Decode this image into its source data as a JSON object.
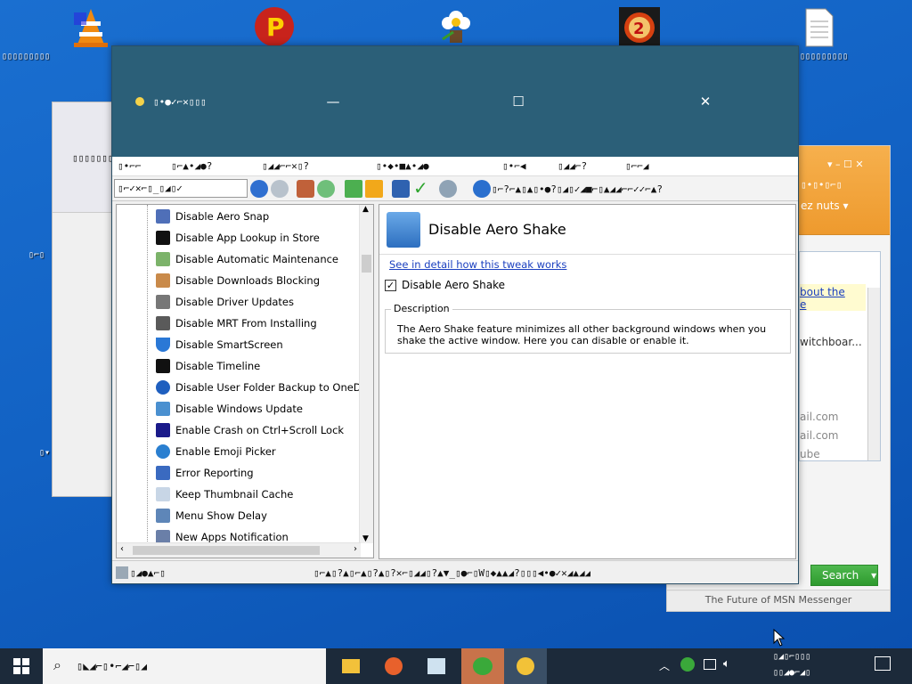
{
  "desktop": {
    "icons": [
      {
        "name": "vlc-icon",
        "label": "▯▯▯▯▯▯▯▯▯"
      },
      {
        "name": "pinball-icon",
        "label": ""
      },
      {
        "name": "flower-app-icon",
        "label": ""
      },
      {
        "name": "pocket-watch-icon",
        "label": ""
      },
      {
        "name": "text-document-icon",
        "label": "▯▯▯▯▯▯▯▯▯"
      }
    ],
    "left_labels": [
      "▯▯▯▯▯▯▯▯▯",
      "▯⌐▯",
      "▯▾"
    ]
  },
  "main_window": {
    "title": "▯•●✓⌐✕▯▯▯",
    "controls": {
      "minimize": "—",
      "maximize": "☐",
      "close": "✕"
    },
    "menu": [
      "▯•⌐⌐",
      "▯⌐▲•◢●?",
      "▯◢◢⌐⌐✕▯?",
      "▯•◆•■▲•◢●",
      "▯•⌐◀",
      "▯◢◢⌐?",
      "▯⌐⌐◢"
    ],
    "toolbar": {
      "address_value": "▯⌐✓✕⌐▯_▯◢▯✓",
      "hint_text": "▯⌐?⌐▲▯▲▯•●?▯◢▯✓◢■⌐▯▲◢◢⌐⌐✓✓⌐▲?"
    },
    "tree_items": [
      "Disable Aero Snap",
      "Disable App Lookup in Store",
      "Disable Automatic Maintenance",
      "Disable Downloads Blocking",
      "Disable Driver Updates",
      "Disable MRT From Installing",
      "Disable SmartScreen",
      "Disable Timeline",
      "Disable User Folder Backup to OneDrive",
      "Disable Windows Update",
      "Enable Crash on Ctrl+Scroll Lock",
      "Enable Emoji Picker",
      "Error Reporting",
      "Keep Thumbnail Cache",
      "Menu Show Delay",
      "New Apps Notification"
    ],
    "detail": {
      "heading": "Disable Aero Shake",
      "link": "See in detail how this tweak works",
      "checkbox_label": "Disable Aero Shake",
      "checkbox_checked": true,
      "group_title": "Description",
      "description": "The Aero Shake feature minimizes all other background windows when you shake the active window. Here you can disable or enable it."
    },
    "status_left": "▯◢●▲⌐▯",
    "status_right": "▯⌐▲▯?▲▯⌐▲▯?▲▯?✕⌐▯◢◢▯?▲▼_▯●⌐▯W▯◆▲▲◢?▯▯▯◀•●✓✕◢▲◢◢"
  },
  "msn_window": {
    "header_text": "ez nuts ▾",
    "header_garble": "▯•▯•▯⌐▯",
    "list_link": "bout the",
    "list_link2": "e",
    "list_items": [
      "witchboar...",
      "ail.com",
      "ail.com",
      "ube"
    ],
    "search_label": "Search",
    "footer": "The Future of MSN Messenger"
  },
  "taskbar": {
    "search_placeholder": "▯◣◢⌐▯•⌐◢⌐▯◢",
    "tray_time": "▯◢▯⌐▯▯▯",
    "tray_date": "▯▯◢●⌐◢▯"
  },
  "colors": {
    "titlebar": "#2b5f78",
    "desktop": "#1262c4",
    "link": "#1a3fbf",
    "msn_header": "#f0a03a",
    "search_button": "#3aa63a"
  }
}
